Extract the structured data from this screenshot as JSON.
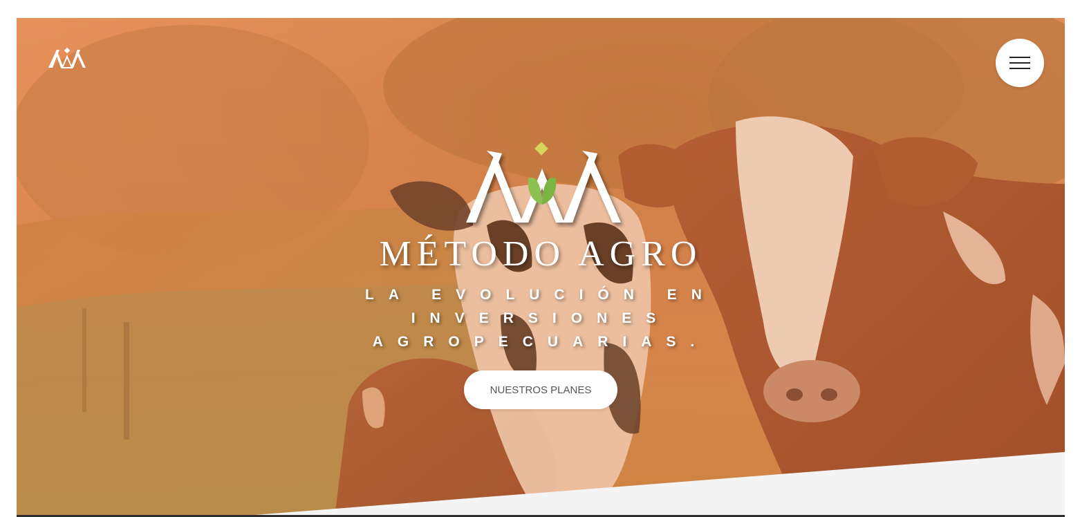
{
  "header": {
    "logo_icon": "metodo-agro-logo-icon",
    "menu_icon": "hamburger-menu-icon"
  },
  "hero": {
    "brand_title": "MÉTODO AGRO",
    "tagline": "LA EVOLUCIÓN EN INVERSIONES AGROPECUARIAS.",
    "cta_label": "NUESTROS PLANES",
    "background_image": "cows-in-pasture-photo"
  },
  "colors": {
    "overlay": "#E0874F",
    "logo_leaf": "#8CC152",
    "logo_diamond": "#D8D35A",
    "white": "#FFFFFF",
    "cta_text": "#555555",
    "bottom_section": "#F4F4F4"
  }
}
